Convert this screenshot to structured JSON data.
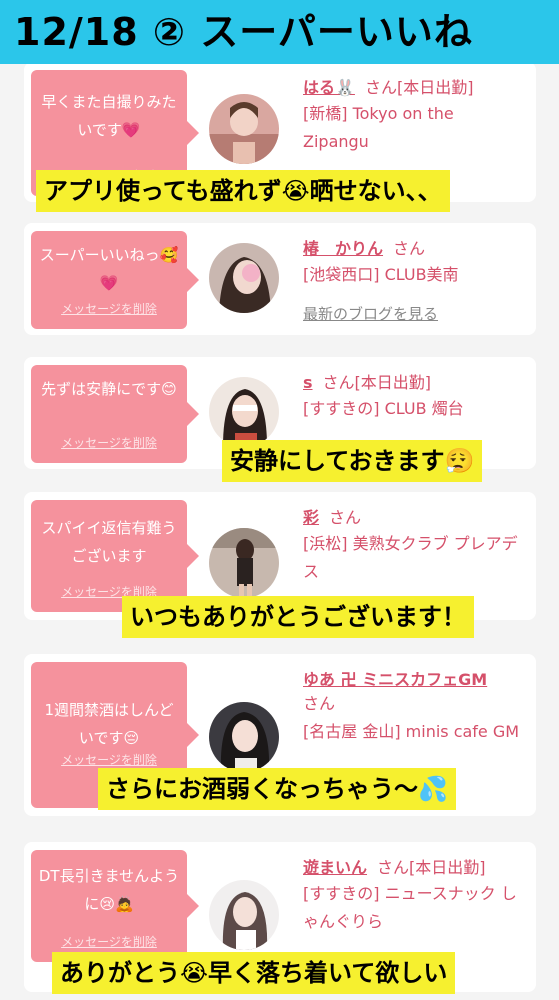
{
  "header": {
    "title": "12/18 ② スーパーいいね"
  },
  "delete_label": "メッセージを削除",
  "cards": [
    {
      "message": "早くまた自撮りみたいです💗",
      "name": "はる🐰",
      "honorific": "さん",
      "status": "[本日出勤]",
      "shop": "[新橋] Tokyo on the Zipangu",
      "caption": "アプリ使っても盛れず😭晒せない、、"
    },
    {
      "message": "スーパーいいねっ🥰💗",
      "name": "椿　かりん",
      "honorific": "さん",
      "status": "",
      "shop": "[池袋西口] CLUB美南",
      "blog": "最新のブログを見る"
    },
    {
      "message": "先ずは安静にです😊",
      "name": "s",
      "honorific": "さん",
      "status": "[本日出勤]",
      "shop": "[すすきの] CLUB 燭台",
      "caption": "安静にしておきます😮‍💨"
    },
    {
      "message": "スパイイ返信有難うございます",
      "name": "彩",
      "honorific": "さん",
      "status": "",
      "shop": "[浜松] 美熟女クラブ プレアデス",
      "caption": "いつもありがとうございます！"
    },
    {
      "message": "1週間禁酒はしんどいです😔",
      "name": "ゆあ 卍 ミニスカフェGM",
      "honorific": "さん",
      "status": "",
      "shop": "[名古屋 金山] minis cafe GM",
      "caption": "さらにお酒弱くなっちゃう〜💦"
    },
    {
      "message": "DT長引きませんように😢🙇",
      "name": "遊まいん",
      "honorific": "さん",
      "status": "[本日出勤]",
      "shop": "[すすきの] ニュースナック しゃんぐりら",
      "caption": "ありがとう😭早く落ち着いて欲しい"
    }
  ],
  "colors": {
    "header_bg": "#2bc6ea",
    "bubble_bg": "#f5929d",
    "name_color": "#d5506a",
    "caption_bg": "#f6f02f"
  }
}
